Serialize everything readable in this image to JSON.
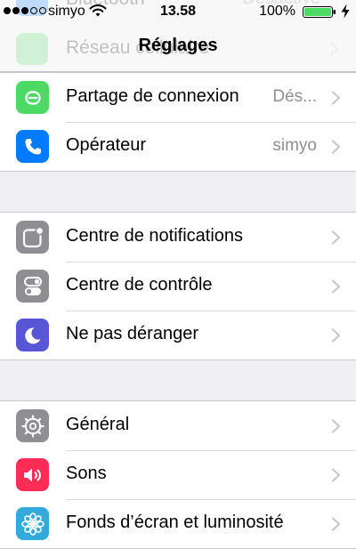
{
  "status_bar": {
    "carrier": "simyo",
    "time": "13.58",
    "battery_percent": "100%",
    "signal_bars_filled": 3,
    "signal_bars_total": 5,
    "battery_level": 1.0,
    "battery_color": "#4cd964"
  },
  "nav": {
    "title": "Réglages"
  },
  "behind_rows": [
    {
      "label": "Bluetooth",
      "value": "Désactivé"
    },
    {
      "label": "Réseau cellulaire",
      "value": ""
    }
  ],
  "groups": [
    {
      "rows": [
        {
          "id": "partage",
          "label": "Partage de connexion",
          "value": "Dés...",
          "icon": "hotspot-icon",
          "color": "#4cd964"
        },
        {
          "id": "operateur",
          "label": "Opérateur",
          "value": "simyo",
          "icon": "phone-icon",
          "color": "#007aff"
        }
      ]
    },
    {
      "rows": [
        {
          "id": "notifications",
          "label": "Centre de notifications",
          "value": "",
          "icon": "notifications-icon",
          "color": "#8e8e93"
        },
        {
          "id": "controle",
          "label": "Centre de contrôle",
          "value": "",
          "icon": "toggles-icon",
          "color": "#8e8e93"
        },
        {
          "id": "deranger",
          "label": "Ne pas déranger",
          "value": "",
          "icon": "moon-icon",
          "color": "#5856d6"
        }
      ]
    },
    {
      "rows": [
        {
          "id": "general",
          "label": "Général",
          "value": "",
          "icon": "gear-icon",
          "color": "#8e8e93"
        },
        {
          "id": "sons",
          "label": "Sons",
          "value": "",
          "icon": "speaker-icon",
          "color": "#ff2d55"
        },
        {
          "id": "fonds",
          "label": "Fonds d’écran et luminosité",
          "value": "",
          "icon": "wallpaper-icon",
          "color": "#34aadc"
        }
      ]
    }
  ]
}
